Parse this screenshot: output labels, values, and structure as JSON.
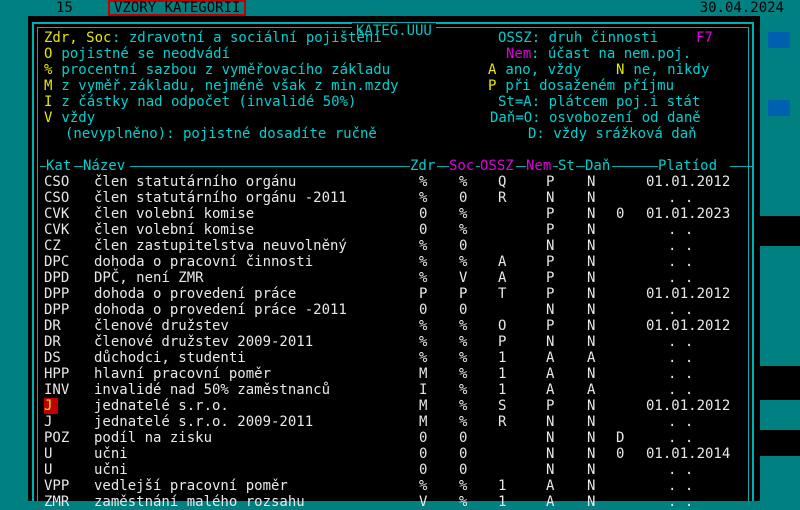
{
  "topbar": {
    "page_number": "15",
    "title": "VZORY KATEGORIÍ",
    "date": "30.04.2024"
  },
  "window": {
    "title": "KATEG.UUU"
  },
  "legend": {
    "l1a": "Zdr, Soc",
    "l1b": ": zdravotní a sociální pojištění",
    "l1c": "OSSZ: druh činnosti",
    "l1d": "F7",
    "l2a": "O",
    "l2b": " pojistné se neodvádí",
    "l2c": "Nem",
    "l2d": ": účast na nem.poj.",
    "l3a": "%",
    "l3b": " procentní sazbou z vyměřovacího základu",
    "l3c": "A",
    "l3d": " ano, vždy ",
    "l3e": "N",
    "l3f": " ne, nikdy",
    "l4a": "M",
    "l4b": " z vyměř.základu, nejméně však z min.mzdy",
    "l4c": "P",
    "l4d": " při dosaženém příjmu",
    "l5a": "I",
    "l5b": " z částky nad odpočet (invalidé 50%)",
    "l5c": "St=A: plátcem poj.i stát",
    "l6a": "V",
    "l6b": " vždy",
    "l6c": "Daň=O: osvobození od daně",
    "l7a": "(nevyplněno): pojistné dosadíte ručně",
    "l7b": "D: vždy srážková daň"
  },
  "table": {
    "columns": [
      "Kat",
      "Název",
      "Zdr",
      "Soc",
      "OSSZ",
      "Nem",
      "St",
      "Daň",
      "Platíod"
    ],
    "rows": [
      {
        "kat": "CSO",
        "nazev": "člen statutárního orgánu",
        "zdr": "%",
        "soc": "%",
        "ossz": "Q",
        "nem": "P",
        "st": "N",
        "dan": "",
        "plati": "01.01.2012"
      },
      {
        "kat": "CSO",
        "nazev": "člen statutárního orgánu -2011",
        "zdr": "%",
        "soc": "0",
        "ossz": "R",
        "nem": "N",
        "st": "N",
        "dan": "",
        "plati": ". ."
      },
      {
        "kat": "CVK",
        "nazev": "člen volební komise",
        "zdr": "0",
        "soc": "%",
        "ossz": "",
        "nem": "P",
        "st": "N",
        "dan": "0",
        "plati": "01.01.2023"
      },
      {
        "kat": "CVK",
        "nazev": "člen volební komise",
        "zdr": "0",
        "soc": "%",
        "ossz": "",
        "nem": "P",
        "st": "N",
        "dan": "",
        "plati": ". ."
      },
      {
        "kat": "CZ",
        "nazev": "člen zastupitelstva neuvolněný",
        "zdr": "%",
        "soc": "0",
        "ossz": "",
        "nem": "N",
        "st": "N",
        "dan": "",
        "plati": ". ."
      },
      {
        "kat": "DPC",
        "nazev": "dohoda o pracovní činnosti",
        "zdr": "%",
        "soc": "%",
        "ossz": "A",
        "nem": "P",
        "st": "N",
        "dan": "",
        "plati": ". ."
      },
      {
        "kat": "DPD",
        "nazev": "DPČ, není ZMR",
        "zdr": "%",
        "soc": "V",
        "ossz": "A",
        "nem": "P",
        "st": "N",
        "dan": "",
        "plati": ". ."
      },
      {
        "kat": "DPP",
        "nazev": "dohoda o provedení práce",
        "zdr": "P",
        "soc": "P",
        "ossz": "T",
        "nem": "P",
        "st": "N",
        "dan": "",
        "plati": "01.01.2012"
      },
      {
        "kat": "DPP",
        "nazev": "dohoda o provedení práce -2011",
        "zdr": "0",
        "soc": "0",
        "ossz": "",
        "nem": "N",
        "st": "N",
        "dan": "",
        "plati": ". ."
      },
      {
        "kat": "DR",
        "nazev": "členové družstev",
        "zdr": "%",
        "soc": "%",
        "ossz": "O",
        "nem": "P",
        "st": "N",
        "dan": "",
        "plati": "01.01.2012"
      },
      {
        "kat": "DR",
        "nazev": "členové družstev 2009-2011",
        "zdr": "%",
        "soc": "%",
        "ossz": "P",
        "nem": "N",
        "st": "N",
        "dan": "",
        "plati": ". ."
      },
      {
        "kat": "DS",
        "nazev": "důchodci, studenti",
        "zdr": "%",
        "soc": "%",
        "ossz": "1",
        "nem": "A",
        "st": "A",
        "dan": "",
        "plati": ". ."
      },
      {
        "kat": "HPP",
        "nazev": "hlavní pracovní poměr",
        "zdr": "M",
        "soc": "%",
        "ossz": "1",
        "nem": "A",
        "st": "N",
        "dan": "",
        "plati": ". ."
      },
      {
        "kat": "INV",
        "nazev": "invalidé nad 50% zaměstnanců",
        "zdr": "I",
        "soc": "%",
        "ossz": "1",
        "nem": "A",
        "st": "A",
        "dan": "",
        "plati": ". ."
      },
      {
        "kat": "J",
        "nazev": "jednatelé s.r.o.",
        "zdr": "M",
        "soc": "%",
        "ossz": "S",
        "nem": "P",
        "st": "N",
        "dan": "",
        "plati": "01.01.2012"
      },
      {
        "kat": "J",
        "nazev": "jednatelé s.r.o. 2009-2011",
        "zdr": "M",
        "soc": "%",
        "ossz": "R",
        "nem": "N",
        "st": "N",
        "dan": "",
        "plati": ". ."
      },
      {
        "kat": "POZ",
        "nazev": "podíl na zisku",
        "zdr": "0",
        "soc": "0",
        "ossz": "",
        "nem": "N",
        "st": "N",
        "dan": "D",
        "plati": ". ."
      },
      {
        "kat": "U",
        "nazev": "učni",
        "zdr": "0",
        "soc": "0",
        "ossz": "",
        "nem": "N",
        "st": "N",
        "dan": "0",
        "plati": "01.01.2014"
      },
      {
        "kat": "U",
        "nazev": "učni",
        "zdr": "0",
        "soc": "0",
        "ossz": "",
        "nem": "N",
        "st": "N",
        "dan": "",
        "plati": ". ."
      },
      {
        "kat": "VPP",
        "nazev": "vedlejší pracovní poměr",
        "zdr": "%",
        "soc": "%",
        "ossz": "1",
        "nem": "A",
        "st": "N",
        "dan": "",
        "plati": ". ."
      },
      {
        "kat": "ZMR",
        "nazev": "zaměstnání malého rozsahu",
        "zdr": "V",
        "soc": "%",
        "ossz": "1",
        "nem": "A",
        "st": "N",
        "dan": "",
        "plati": ". ."
      }
    ]
  },
  "colors": {
    "screen_bg": "#008080",
    "window_bg": "#000000",
    "text": "#00d0d0",
    "highlight": "#e8e800",
    "accent": "#e000e0",
    "selection": "#c00000"
  }
}
